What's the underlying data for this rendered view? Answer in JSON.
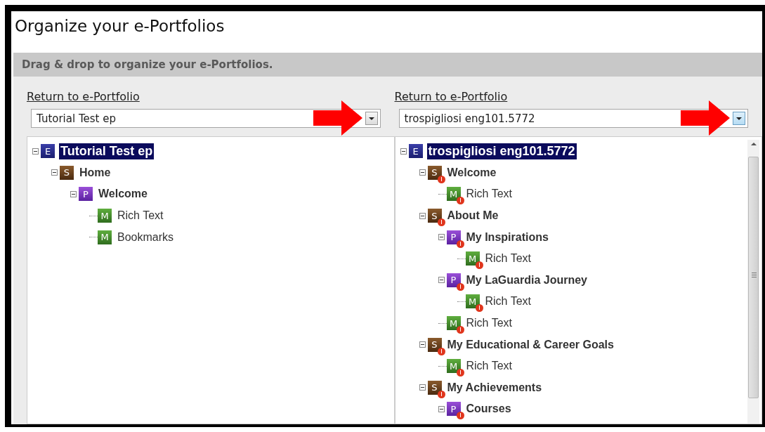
{
  "page": {
    "title": "Organize your e-Portfolios"
  },
  "banner": {
    "text": "Drag & drop to organize your e-Portfolios."
  },
  "panels": [
    {
      "link": "Return to e-Portfolio",
      "select": {
        "value": "Tutorial Test ep",
        "highlighted": false
      },
      "scrollbar": false,
      "tree": [
        {
          "label": "Tutorial Test ep",
          "badge": "E",
          "kind": "eportfolio",
          "selected": true,
          "warning": false,
          "expanded": true,
          "children": [
            {
              "label": "Home",
              "badge": "S",
              "kind": "section",
              "selected": false,
              "warning": false,
              "expanded": true,
              "children": [
                {
                  "label": "Welcome",
                  "badge": "P",
                  "kind": "page",
                  "selected": false,
                  "warning": false,
                  "expanded": true,
                  "children": [
                    {
                      "label": "Rich Text",
                      "badge": "M",
                      "kind": "module",
                      "selected": false,
                      "warning": false
                    },
                    {
                      "label": "Bookmarks",
                      "badge": "M",
                      "kind": "module",
                      "selected": false,
                      "warning": false
                    }
                  ]
                }
              ]
            }
          ]
        }
      ]
    },
    {
      "link": "Return to e-Portfolio",
      "select": {
        "value": "trospigliosi eng101.5772",
        "highlighted": true
      },
      "scrollbar": true,
      "tree": [
        {
          "label": "trospigliosi eng101.5772",
          "badge": "E",
          "kind": "eportfolio",
          "selected": true,
          "warning": false,
          "expanded": true,
          "children": [
            {
              "label": "Welcome",
              "badge": "S",
              "kind": "section",
              "selected": false,
              "warning": true,
              "expanded": true,
              "children": [
                {
                  "label": "Rich Text",
                  "badge": "M",
                  "kind": "module",
                  "selected": false,
                  "warning": true
                }
              ]
            },
            {
              "label": "About Me",
              "badge": "S",
              "kind": "section",
              "selected": false,
              "warning": true,
              "expanded": true,
              "children": [
                {
                  "label": "My Inspirations",
                  "badge": "P",
                  "kind": "page",
                  "selected": false,
                  "warning": true,
                  "expanded": true,
                  "children": [
                    {
                      "label": "Rich Text",
                      "badge": "M",
                      "kind": "module",
                      "selected": false,
                      "warning": true
                    }
                  ]
                },
                {
                  "label": "My LaGuardia Journey",
                  "badge": "P",
                  "kind": "page",
                  "selected": false,
                  "warning": true,
                  "expanded": true,
                  "children": [
                    {
                      "label": "Rich Text",
                      "badge": "M",
                      "kind": "module",
                      "selected": false,
                      "warning": true
                    }
                  ]
                },
                {
                  "label": "Rich Text",
                  "badge": "M",
                  "kind": "module",
                  "selected": false,
                  "warning": true
                }
              ]
            },
            {
              "label": "My Educational & Career Goals",
              "badge": "S",
              "kind": "section",
              "selected": false,
              "warning": true,
              "expanded": true,
              "children": [
                {
                  "label": "Rich Text",
                  "badge": "M",
                  "kind": "module",
                  "selected": false,
                  "warning": true
                }
              ]
            },
            {
              "label": "My Achievements",
              "badge": "S",
              "kind": "section",
              "selected": false,
              "warning": true,
              "expanded": true,
              "children": [
                {
                  "label": "Courses",
                  "badge": "P",
                  "kind": "page",
                  "selected": false,
                  "warning": true,
                  "expanded": true
                }
              ]
            }
          ]
        }
      ]
    }
  ]
}
